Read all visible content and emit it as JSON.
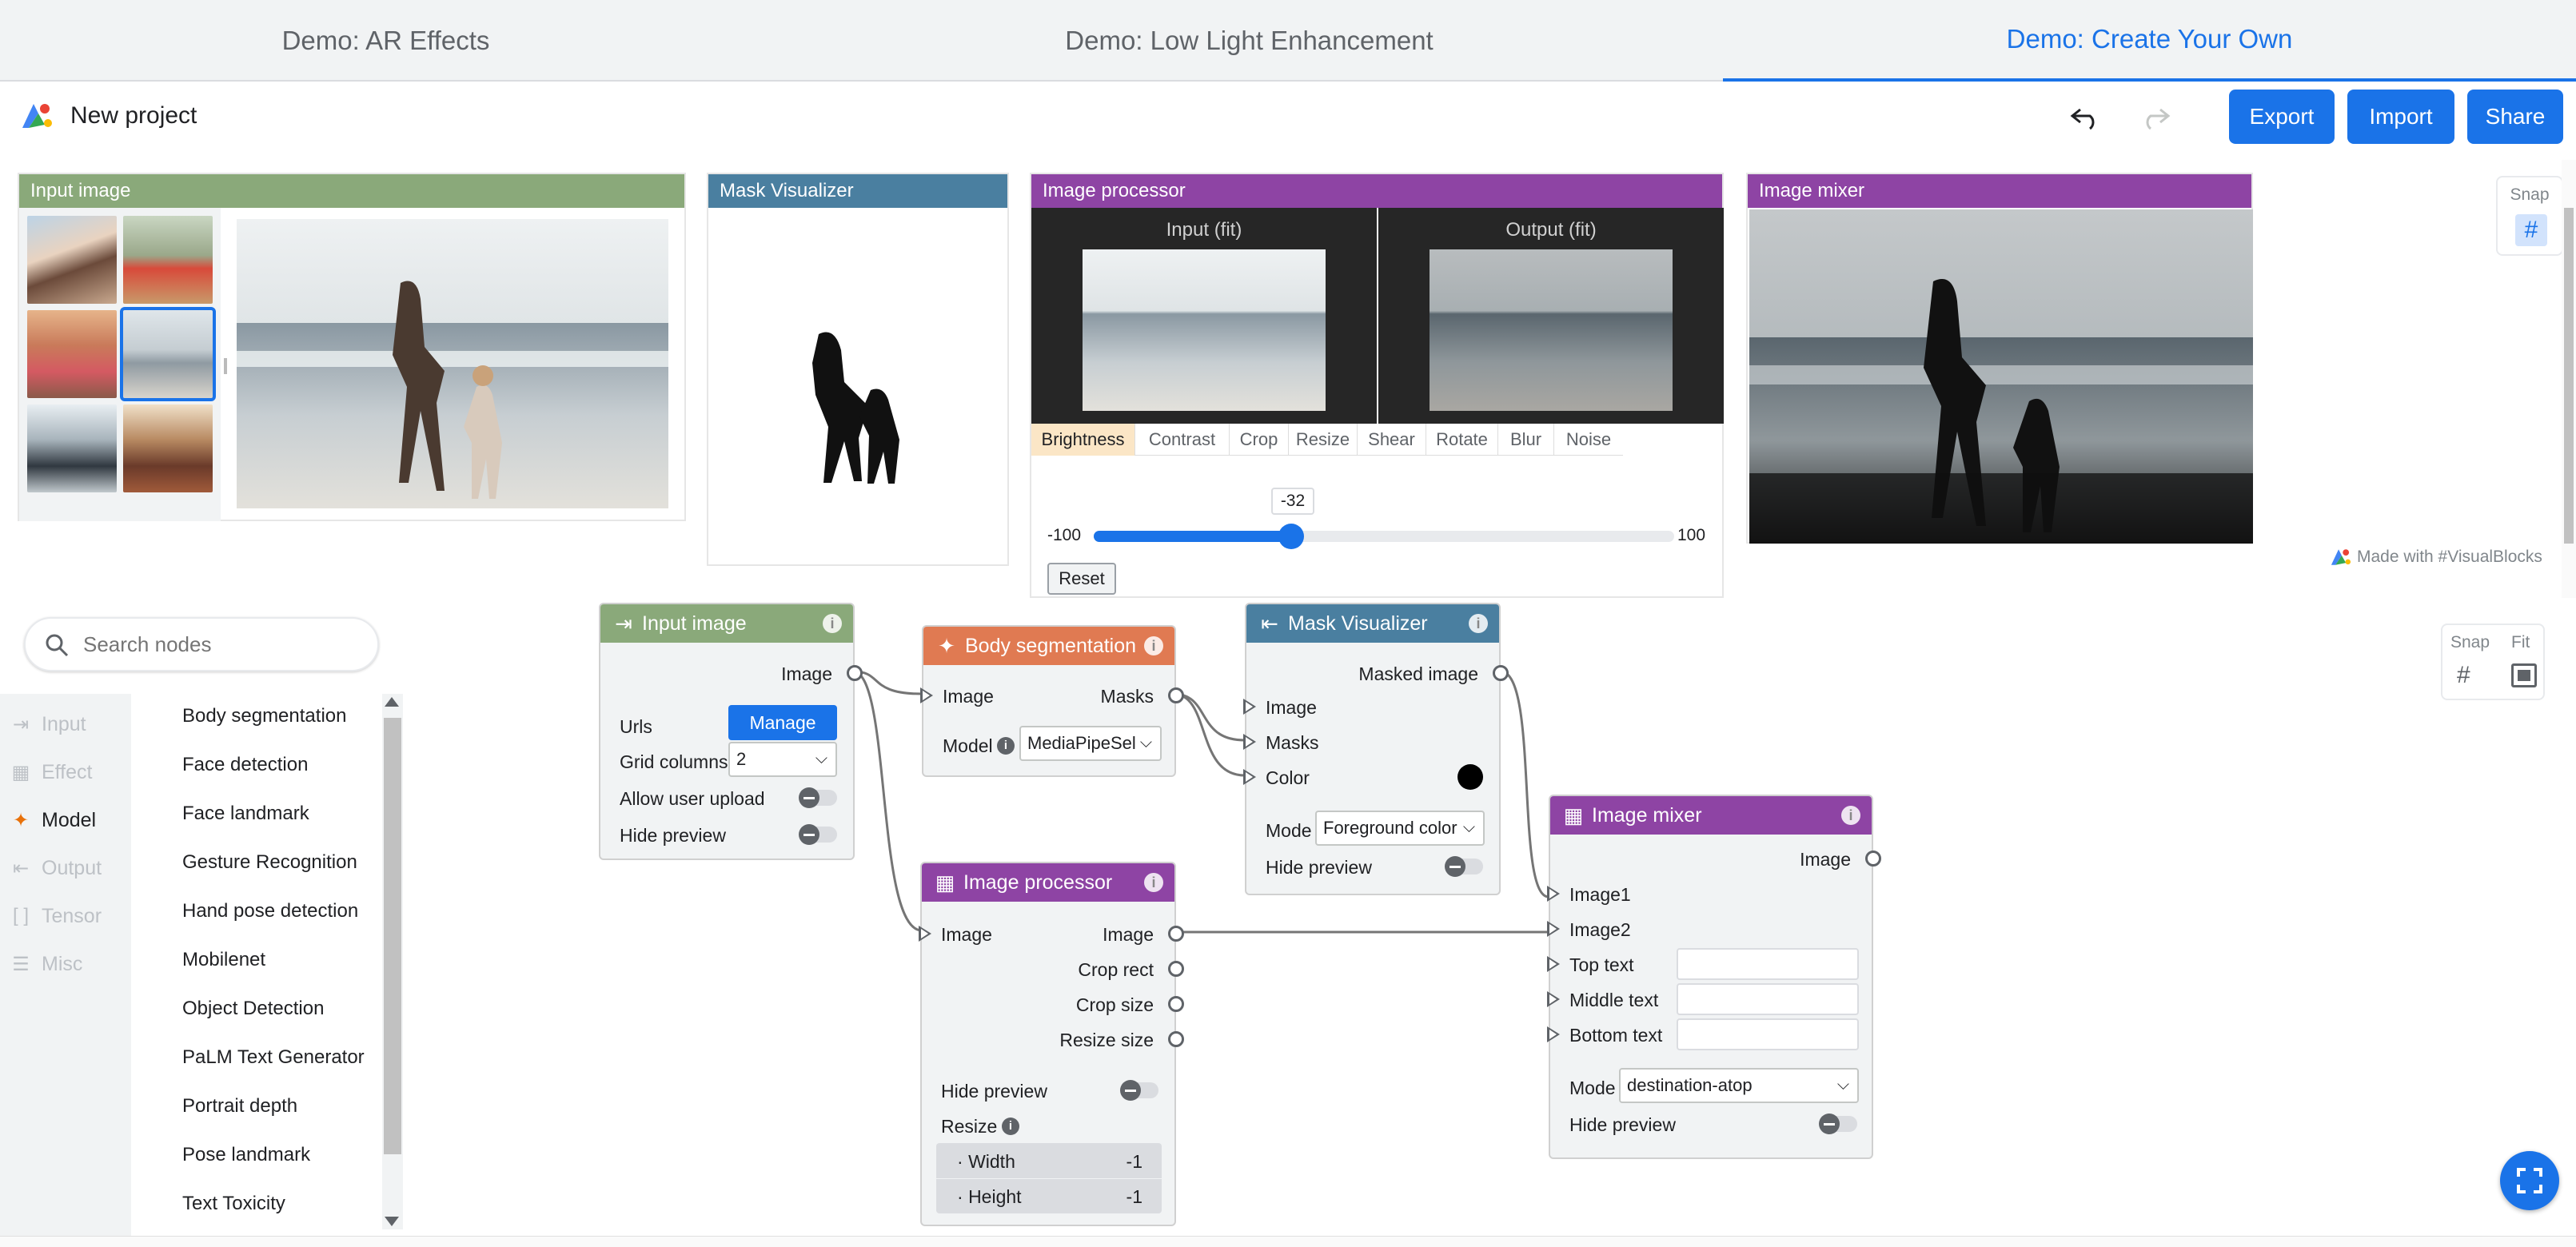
{
  "tabs": [
    "Demo: AR Effects",
    "Demo: Low Light Enhancement",
    "Demo: Create Your Own"
  ],
  "header": {
    "project_name": "New project",
    "export_label": "Export",
    "import_label": "Import",
    "share_label": "Share"
  },
  "preview": {
    "input_image_title": "Input image",
    "mask_visualizer_title": "Mask Visualizer",
    "image_processor_title": "Image processor",
    "image_mixer_title": "Image mixer",
    "input_fit_label": "Input (fit)",
    "output_fit_label": "Output (fit)",
    "processor_tabs": [
      "Brightness",
      "Contrast",
      "Crop",
      "Resize",
      "Shear",
      "Rotate",
      "Blur",
      "Noise"
    ],
    "slider": {
      "value": "-32",
      "min": "-100",
      "max": "100",
      "fraction": 0.34
    },
    "reset_label": "Reset",
    "made_with": "Made with #VisualBlocks",
    "snap_label": "Snap"
  },
  "sidebar": {
    "search_placeholder": "Search nodes",
    "categories": [
      "Input",
      "Effect",
      "Model",
      "Output",
      "Tensor",
      "Misc"
    ],
    "active_category": "Model",
    "nodes": [
      "Body segmentation",
      "Face detection",
      "Face landmark",
      "Gesture Recognition",
      "Hand pose detection",
      "Mobilenet",
      "Object Detection",
      "PaLM Text Generator",
      "Portrait depth",
      "Pose landmark",
      "Text Toxicity"
    ]
  },
  "canvas": {
    "snap_label": "Snap",
    "fit_label": "Fit",
    "input_node": {
      "title": "Input image",
      "image_out": "Image",
      "urls_label": "Urls",
      "manage_label": "Manage",
      "grid_columns_label": "Grid columns",
      "grid_columns_value": "2",
      "allow_upload_label": "Allow user upload",
      "hide_preview_label": "Hide preview"
    },
    "body_seg_node": {
      "title": "Body segmentation",
      "image_in": "Image",
      "masks_out": "Masks",
      "model_label": "Model",
      "model_value": "MediaPipeSel"
    },
    "mask_vis_node": {
      "title": "Mask Visualizer",
      "masked_out": "Masked image",
      "image_in": "Image",
      "masks_in": "Masks",
      "color_in": "Color",
      "mode_label": "Mode",
      "mode_value": "Foreground color",
      "hide_preview_label": "Hide preview"
    },
    "processor_node": {
      "title": "Image processor",
      "image_in": "Image",
      "image_out": "Image",
      "crop_rect": "Crop rect",
      "crop_size": "Crop size",
      "resize_size": "Resize size",
      "hide_preview_label": "Hide preview",
      "resize_label": "Resize",
      "width_label": "Width",
      "width_value": "-1",
      "height_label": "Height",
      "height_value": "-1"
    },
    "mixer_node": {
      "title": "Image mixer",
      "image_out": "Image",
      "image1_in": "Image1",
      "image2_in": "Image2",
      "top_text": "Top text",
      "middle_text": "Middle text",
      "bottom_text": "Bottom text",
      "mode_label": "Mode",
      "mode_value": "destination-atop",
      "hide_preview_label": "Hide preview"
    }
  },
  "colors": {
    "input_green": "#8aa97a",
    "mask_blue": "#4a7fa0",
    "processor_purple": "#8e44a4",
    "body_orange": "#e07a52",
    "accent": "#1a73e8"
  }
}
